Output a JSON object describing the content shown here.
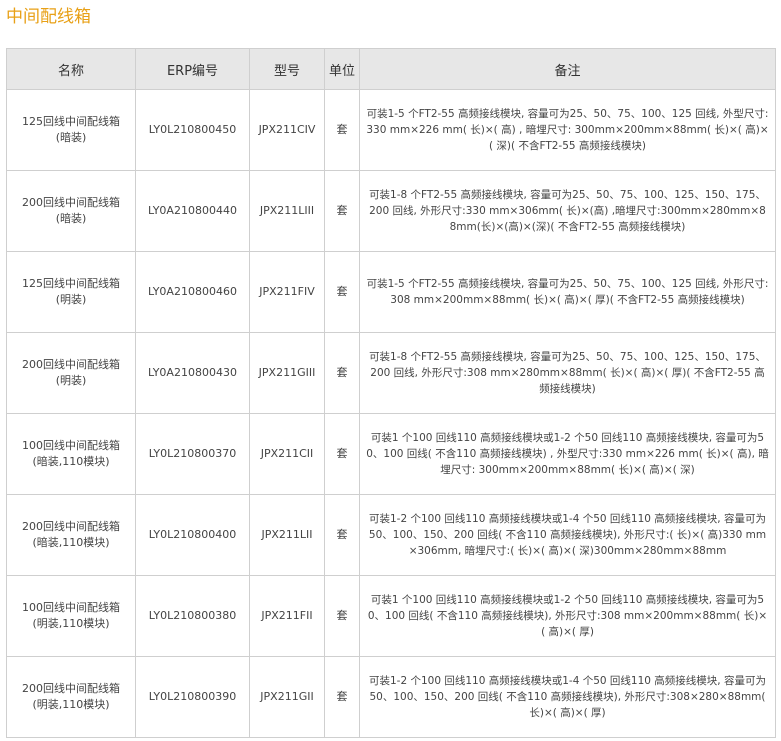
{
  "page": {
    "title": "中间配线箱"
  },
  "table": {
    "headers": [
      "名称",
      "ERP编号",
      "型号",
      "单位",
      "备注"
    ],
    "rows": [
      {
        "name": "125回线中间配线箱\n(暗装)",
        "erp": "LY0L210800450",
        "model": "JPX211CIV",
        "unit": "套",
        "note": "可装1-5 个FT2-55 高频接线模块, 容量可为25、50、75、100、125 回线, 外型尺寸:330 mm×226 mm( 长)×( 高) , 暗埋尺寸: 300mm×200mm×88mm( 长)×( 高)×( 深)( 不含FT2-55 高频接线模块)"
      },
      {
        "name": "200回线中间配线箱\n(暗装)",
        "erp": "LY0A210800440",
        "model": "JPX211LIII",
        "unit": "套",
        "note": "可装1-8 个FT2-55 高频接线模块, 容量可为25、50、75、100、125、150、175、200 回线, 外形尺寸:330 mm×306mm( 长)×(高) ,暗埋尺寸:300mm×280mm×88mm(长)×(高)×(深)( 不含FT2-55 高频接线模块)"
      },
      {
        "name": "125回线中间配线箱\n(明装)",
        "erp": "LY0A210800460",
        "model": "JPX211FIV",
        "unit": "套",
        "note": "可装1-5 个FT2-55 高频接线模块, 容量可为25、50、75、100、125 回线, 外形尺寸:308 mm×200mm×88mm( 长)×( 高)×( 厚)( 不含FT2-55 高频接线模块)"
      },
      {
        "name": "200回线中间配线箱\n(明装)",
        "erp": "LY0A210800430",
        "model": "JPX211GIII",
        "unit": "套",
        "note": "可装1-8 个FT2-55 高频接线模块, 容量可为25、50、75、100、125、150、175、200 回线, 外形尺寸:308 mm×280mm×88mm( 长)×( 高)×( 厚)( 不含FT2-55 高频接线模块)"
      },
      {
        "name": "100回线中间配线箱\n(暗装,110模块)",
        "erp": "LY0L210800370",
        "model": "JPX211CII",
        "unit": "套",
        "note": "可装1 个100 回线110 高频接线模块或1-2 个50 回线110 高频接线模块, 容量可为50、100 回线( 不含110 高频接线模块) , 外型尺寸:330 mm×226 mm( 长)×( 高), 暗埋尺寸: 300mm×200mm×88mm( 长)×( 高)×( 深)"
      },
      {
        "name": "200回线中间配线箱\n(暗装,110模块)",
        "erp": "LY0L210800400",
        "model": "JPX211LII",
        "unit": "套",
        "note": "可装1-2 个100 回线110 高频接线模块或1-4 个50 回线110 高频接线模块, 容量可为50、100、150、200 回线( 不含110 高频接线模块), 外形尺寸:( 长)×( 高)330 mm×306mm, 暗埋尺寸:( 长)×( 高)×( 深)300mm×280mm×88mm"
      },
      {
        "name": "100回线中间配线箱\n(明装,110模块)",
        "erp": "LY0L210800380",
        "model": "JPX211FII",
        "unit": "套",
        "note": "可装1 个100 回线110 高频接线模块或1-2 个50 回线110 高频接线模块, 容量可为50、100 回线( 不含110 高频接线模块), 外形尺寸:308 mm×200mm×88mm( 长)×( 高)×( 厚)"
      },
      {
        "name": "200回线中间配线箱\n(明装,110模块)",
        "erp": "LY0L210800390",
        "model": "JPX211GII",
        "unit": "套",
        "note": "可装1-2 个100 回线110 高频接线模块或1-4 个50 回线110 高频接线模块, 容量可为50、100、150、200 回线( 不含110 高频接线模块), 外形尺寸:308×280×88mm( 长)×( 高)×( 厚)"
      }
    ]
  }
}
